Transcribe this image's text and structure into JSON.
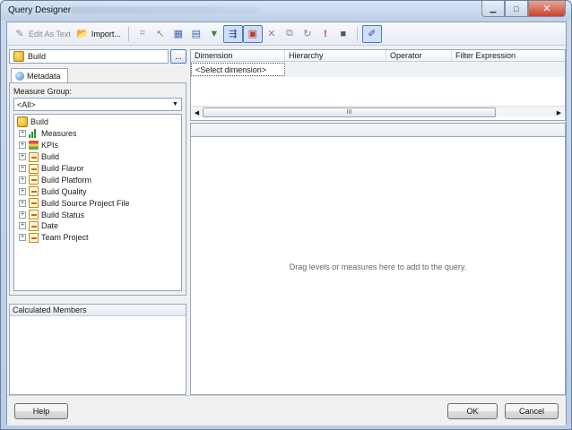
{
  "window": {
    "title": "Query Designer"
  },
  "toolbar": {
    "edit_as_text": "Edit As Text",
    "import": "Import..."
  },
  "cube": {
    "name": "Build",
    "browse_label": "..."
  },
  "tabs": {
    "metadata": "Metadata"
  },
  "measure_group": {
    "label": "Measure Group:",
    "selected": "<All>"
  },
  "tree": {
    "root": "Build",
    "items": [
      {
        "label": "Measures",
        "icon": "measures-icon"
      },
      {
        "label": "KPIs",
        "icon": "kpi-icon"
      },
      {
        "label": "Build",
        "icon": "dimension-icon"
      },
      {
        "label": "Build Flavor",
        "icon": "dimension-icon"
      },
      {
        "label": "Build Platform",
        "icon": "dimension-icon"
      },
      {
        "label": "Build Quality",
        "icon": "dimension-icon"
      },
      {
        "label": "Build Source Project File",
        "icon": "dimension-icon"
      },
      {
        "label": "Build Status",
        "icon": "dimension-icon"
      },
      {
        "label": "Date",
        "icon": "dimension-icon"
      },
      {
        "label": "Team Project",
        "icon": "dimension-icon"
      }
    ]
  },
  "calculated_members": {
    "header": "Calculated Members"
  },
  "filter_grid": {
    "columns": [
      "Dimension",
      "Hierarchy",
      "Operator",
      "Filter Expression"
    ],
    "placeholder_row": "<Select dimension>",
    "scroll_thumb": "III"
  },
  "drop_area": {
    "hint": "Drag levels or measures here to add to the query."
  },
  "buttons": {
    "help": "Help",
    "ok": "OK",
    "cancel": "Cancel"
  }
}
